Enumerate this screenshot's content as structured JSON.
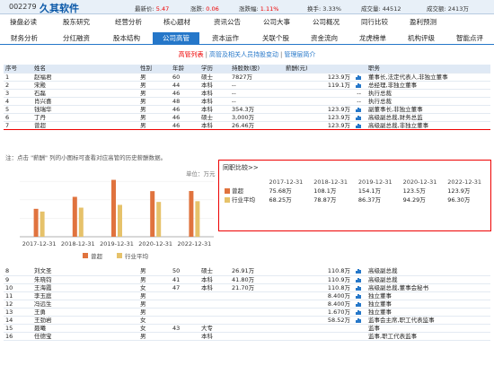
{
  "header": {
    "code": "002279",
    "name": "久其软件",
    "quotes": [
      {
        "label": "最新价:",
        "value": "5.47",
        "color": "#e00"
      },
      {
        "label": "涨跌:",
        "value": "0.06",
        "color": "#e00"
      },
      {
        "label": "涨跌幅:",
        "value": "1.11%",
        "color": "#e00"
      },
      {
        "label": "换手:",
        "value": "3.33%",
        "color": "#333"
      },
      {
        "label": "成交量:",
        "value": "44512",
        "color": "#333"
      },
      {
        "label": "成交额:",
        "value": "2413万",
        "color": "#333"
      }
    ]
  },
  "nav_row1": [
    "操盘必读",
    "股东研究",
    "经营分析",
    "核心题材",
    "资讯公告",
    "公司大事",
    "公司概况",
    "同行比较",
    "盈利预测"
  ],
  "nav_row2": [
    "财务分析",
    "分红融资",
    "股本结构",
    "公司高管",
    "资本运作",
    "关联个股",
    "资金流向",
    "龙虎榜单",
    "机构评级",
    "智能点评"
  ],
  "active_nav": "公司高管",
  "subtabs": [
    "高管列表",
    "高管及相关人员持股变动",
    "管理层简介"
  ],
  "active_subtab": "高管列表",
  "table_headers": [
    "序号",
    "姓名",
    "性别",
    "年龄",
    "学历",
    "持股数(股)",
    "薪酬(元)",
    "职务"
  ],
  "top_rows": [
    {
      "no": "1",
      "name": "赵福君",
      "sex": "男",
      "age": "60",
      "edu": "硕士",
      "shares": "7827万",
      "pay": "123.9万",
      "post": "董事长,法定代表人,非独立董事"
    },
    {
      "no": "2",
      "name": "宋殿",
      "sex": "男",
      "age": "44",
      "edu": "本科",
      "shares": "--",
      "pay": "119.1万",
      "post": "总经理,非独立董事"
    },
    {
      "no": "3",
      "name": "石磊",
      "sex": "男",
      "age": "46",
      "edu": "本科",
      "shares": "--",
      "pay": "--",
      "post": "执行总裁"
    },
    {
      "no": "4",
      "name": "肖兴喜",
      "sex": "男",
      "age": "48",
      "edu": "本科",
      "shares": "--",
      "pay": "--",
      "post": "执行总裁"
    },
    {
      "no": "5",
      "name": "钱瑞华",
      "sex": "男",
      "age": "46",
      "edu": "本科",
      "shares": "354.3万",
      "pay": "123.9万",
      "post": "副董事长,非独立董事"
    },
    {
      "no": "6",
      "name": "丁丹",
      "sex": "男",
      "age": "46",
      "edu": "硕士",
      "shares": "3,000万",
      "pay": "123.9万",
      "post": "高级副总裁,财务总监"
    },
    {
      "no": "7",
      "name": "曾超",
      "sex": "男",
      "age": "46",
      "edu": "本科",
      "shares": "26.46万",
      "pay": "123.9万",
      "post": "高级副总裁,非独立董事"
    }
  ],
  "selected_row": "7",
  "note": "注：点击 \"薪酬\" 列的小图标可查看对应高管的历史薪酬数据。",
  "chart_unit": "单位：万元",
  "chart_data": {
    "type": "bar",
    "categories": [
      "2017-12-31",
      "2018-12-31",
      "2019-12-31",
      "2020-12-31",
      "2022-12-31"
    ],
    "series": [
      {
        "name": "曾超",
        "values": [
          75.68,
          108.1,
          154.1,
          123.5,
          123.9
        ],
        "color": "#e0733e"
      },
      {
        "name": "行业平均",
        "values": [
          68.25,
          78.87,
          86.37,
          94.29,
          96.3
        ],
        "color": "#e6c26a"
      }
    ],
    "ylim": [
      0,
      170
    ],
    "grid": true,
    "legend": "bottom"
  },
  "popup": {
    "title": "同职比较>>",
    "years": [
      "2017-12-31",
      "2018-12-31",
      "2019-12-31",
      "2020-12-31",
      "2022-12-31"
    ],
    "rows": [
      {
        "name": "曾超",
        "color": "#e0733e",
        "values": [
          "75.68万",
          "108.1万",
          "154.1万",
          "123.5万",
          "123.9万"
        ]
      },
      {
        "name": "行业平均",
        "color": "#e6c26a",
        "values": [
          "68.25万",
          "78.87万",
          "86.37万",
          "94.29万",
          "96.30万"
        ]
      }
    ]
  },
  "bottom_rows": [
    {
      "no": "8",
      "name": "刘文圣",
      "sex": "男",
      "age": "50",
      "edu": "硕士",
      "shares": "26.91万",
      "pay": "110.8万",
      "post": "高级副总裁"
    },
    {
      "no": "9",
      "name": "朱晓钧",
      "sex": "男",
      "age": "41",
      "edu": "本科",
      "shares": "41.80万",
      "pay": "110.9万",
      "post": "高级副总裁"
    },
    {
      "no": "10",
      "name": "王海霞",
      "sex": "女",
      "age": "47",
      "edu": "本科",
      "shares": "21.70万",
      "pay": "110.8万",
      "post": "高级副总裁,董事会秘书"
    },
    {
      "no": "11",
      "name": "李玉庭",
      "sex": "男",
      "age": "",
      "edu": "",
      "shares": "",
      "pay": "8.400万",
      "post": "独立董事"
    },
    {
      "no": "12",
      "name": "冯远生",
      "sex": "男",
      "age": "",
      "edu": "",
      "shares": "",
      "pay": "8.400万",
      "post": "独立董事"
    },
    {
      "no": "13",
      "name": "王勇",
      "sex": "男",
      "age": "",
      "edu": "",
      "shares": "",
      "pay": "1.670万",
      "post": "独立董事"
    },
    {
      "no": "14",
      "name": "王劲岩",
      "sex": "女",
      "age": "",
      "edu": "",
      "shares": "",
      "pay": "58.52万",
      "post": "监事会主席,职工代表监事"
    },
    {
      "no": "15",
      "name": "聂曦",
      "sex": "女",
      "age": "43",
      "edu": "大专",
      "shares": "",
      "pay": "",
      "post": "监事"
    },
    {
      "no": "16",
      "name": "任德宝",
      "sex": "男",
      "age": "",
      "edu": "本科",
      "shares": "",
      "pay": "",
      "post": "监事,职工代表监事"
    }
  ]
}
